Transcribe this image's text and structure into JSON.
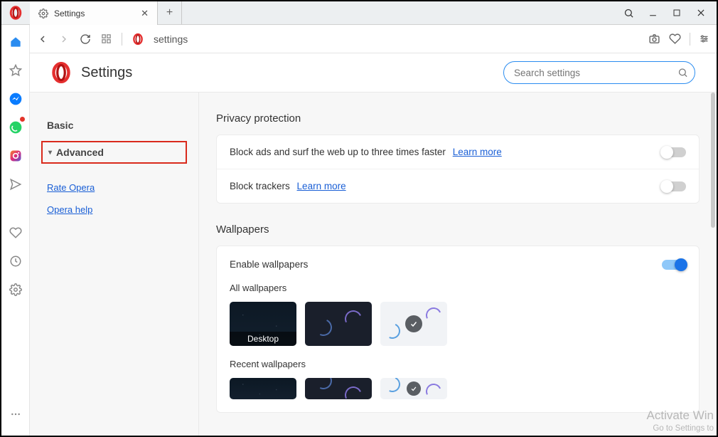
{
  "tab": {
    "title": "Settings"
  },
  "addr": {
    "url": "settings"
  },
  "header": {
    "title": "Settings"
  },
  "search": {
    "placeholder": "Search settings"
  },
  "sidebar": {
    "basic": "Basic",
    "advanced": "Advanced",
    "links": [
      "Rate Opera",
      "Opera help"
    ]
  },
  "privacy": {
    "section_title": "Privacy protection",
    "rows": [
      {
        "text": "Block ads and surf the web up to three times faster",
        "link": "Learn more",
        "on": false
      },
      {
        "text": "Block trackers",
        "link": "Learn more",
        "on": false
      }
    ]
  },
  "wallpapers": {
    "section_title": "Wallpapers",
    "enable_label": "Enable wallpapers",
    "enable_on": true,
    "all_label": "All wallpapers",
    "desktop_label": "Desktop",
    "recent_label": "Recent wallpapers"
  },
  "watermark": {
    "line1": "Activate Win",
    "line2": "Go to Settings to"
  }
}
